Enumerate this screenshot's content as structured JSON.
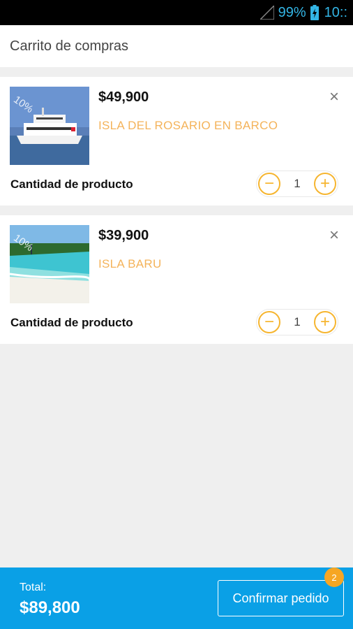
{
  "status_bar": {
    "battery": "99%",
    "time": "10::"
  },
  "header": {
    "title": "Carrito de compras"
  },
  "cart": {
    "items": [
      {
        "discount": "10%",
        "price": "$49,900",
        "name": "ISLA DEL ROSARIO EN BARCO",
        "remove": "×",
        "qty_label": "Cantidad de producto",
        "minus": "−",
        "quantity": "1",
        "plus": "+"
      },
      {
        "discount": "10%",
        "price": "$39,900",
        "name": "ISLA BARU",
        "remove": "×",
        "qty_label": "Cantidad de producto",
        "minus": "−",
        "quantity": "1",
        "plus": "+"
      }
    ]
  },
  "footer": {
    "total_label": "Total:",
    "total_value": "$89,800",
    "confirm_label": "Confirmar pedido",
    "badge_count": "2"
  },
  "colors": {
    "accent": "#0aa0e6",
    "orange": "#f6b52f",
    "name_text": "#f4b35a"
  },
  "icons": [
    "signal-icon",
    "battery-icon",
    "close-icon",
    "minus-icon",
    "plus-icon"
  ]
}
